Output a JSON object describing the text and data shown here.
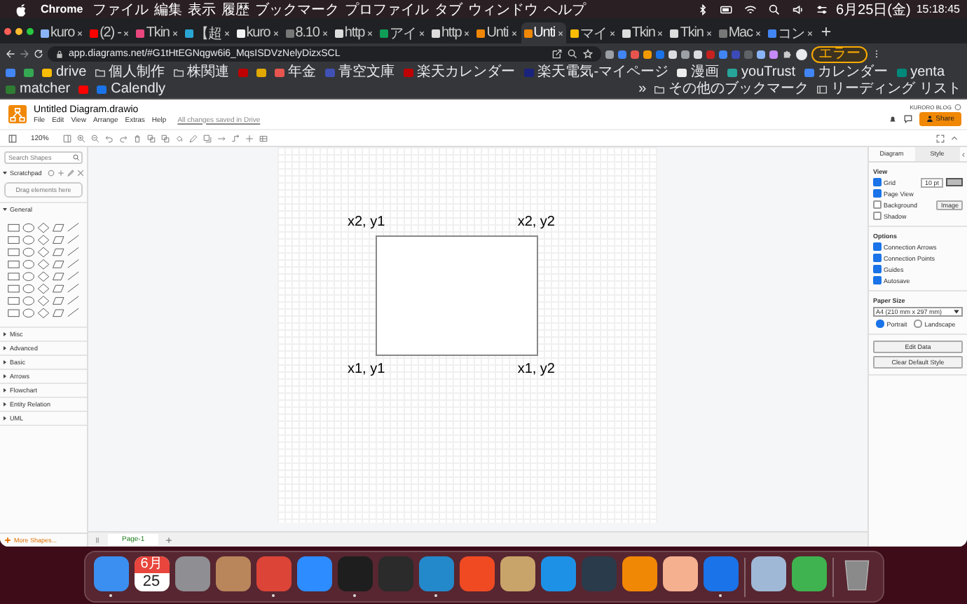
{
  "menubar": {
    "app": "Chrome",
    "menus": [
      "ファイル",
      "編集",
      "表示",
      "履歴",
      "ブックマーク",
      "プロファイル",
      "タブ",
      "ウィンドウ",
      "ヘルプ"
    ],
    "date": "6月25日(金)",
    "time": "15:18:45"
  },
  "tabs": [
    {
      "title": "kuro",
      "color": "#8ab4f8",
      "selected": false
    },
    {
      "title": "(2) -",
      "color": "#ff0000",
      "selected": false
    },
    {
      "title": "Tkin",
      "color": "#e8467c",
      "selected": false
    },
    {
      "title": "【超",
      "color": "#2aa6d5",
      "selected": false
    },
    {
      "title": "kuro",
      "color": "#f1f3f4",
      "selected": false
    },
    {
      "title": "8.10",
      "color": "#777777",
      "selected": false
    },
    {
      "title": "http",
      "color": "#dddddd",
      "selected": false
    },
    {
      "title": "アイ",
      "color": "#0f9d58",
      "selected": false
    },
    {
      "title": "http",
      "color": "#dddddd",
      "selected": false
    },
    {
      "title": "Unti",
      "color": "#f08705",
      "selected": false
    },
    {
      "title": "Unti",
      "color": "#f08705",
      "selected": true
    },
    {
      "title": "マイ",
      "color": "#fbbc04",
      "selected": false
    },
    {
      "title": "Tkin",
      "color": "#dddddd",
      "selected": false
    },
    {
      "title": "Tkin",
      "color": "#dddddd",
      "selected": false
    },
    {
      "title": "Mac",
      "color": "#777777",
      "selected": false
    },
    {
      "title": "コン",
      "color": "#4285f4",
      "selected": false
    }
  ],
  "address": "app.diagrams.net/#G1tHtEGNqgw6i6_MqsISDVzNelyDizxSCL",
  "profile_button": "エラー",
  "bookmarks": {
    "items": [
      {
        "kind": "site",
        "color": "#4285f4"
      },
      {
        "kind": "site",
        "color": "#34a853"
      },
      {
        "kind": "site",
        "color": "#fbbc04",
        "label": "drive"
      },
      {
        "kind": "folder",
        "label": "個人制作"
      },
      {
        "kind": "folder",
        "label": "株関連"
      },
      {
        "kind": "site",
        "color": "#bf0000"
      },
      {
        "kind": "site",
        "color": "#e0a800"
      },
      {
        "kind": "site",
        "color": "#e8554e",
        "label": "年金"
      },
      {
        "kind": "site",
        "color": "#3f51b5",
        "label": "青空文庫"
      },
      {
        "kind": "site",
        "color": "#bf0000",
        "label": "楽天カレンダー"
      },
      {
        "kind": "site",
        "color": "#1a237e",
        "label": "楽天電気-マイページ"
      },
      {
        "kind": "site",
        "color": "#eeeeee",
        "label": "漫画"
      },
      {
        "kind": "site",
        "color": "#26a69a",
        "label": "youTrust"
      },
      {
        "kind": "site",
        "color": "#4285f4",
        "label": "カレンダー"
      },
      {
        "kind": "site",
        "color": "#00897b",
        "label": "yenta"
      },
      {
        "kind": "site",
        "color": "#2e7d32",
        "label": "matcher"
      },
      {
        "kind": "site",
        "color": "#ff0000"
      },
      {
        "kind": "site",
        "color": "#1a73e8",
        "label": "Calendly"
      }
    ],
    "overflow": "»",
    "other": "その他のブックマーク",
    "reading_list": "リーディング リスト"
  },
  "app": {
    "title": "Untitled Diagram.drawio",
    "menus": [
      "File",
      "Edit",
      "View",
      "Arrange",
      "Extras",
      "Help"
    ],
    "save_status": "All changes saved in Drive",
    "account": "KURORO BLOG",
    "share": "Share",
    "zoom": "120%"
  },
  "sidebar": {
    "search_placeholder": "Search Shapes",
    "sections": [
      {
        "title": "Scratchpad",
        "kind": "scratchpad",
        "expanded": true,
        "hint": "Drag elements here"
      },
      {
        "title": "General",
        "kind": "shapes",
        "expanded": true
      },
      {
        "title": "Misc",
        "kind": "shapes",
        "expanded": false
      },
      {
        "title": "Advanced",
        "kind": "shapes",
        "expanded": false
      },
      {
        "title": "Basic",
        "kind": "shapes",
        "expanded": false
      },
      {
        "title": "Arrows",
        "kind": "shapes",
        "expanded": false
      },
      {
        "title": "Flowchart",
        "kind": "shapes",
        "expanded": false
      },
      {
        "title": "Entity Relation",
        "kind": "shapes",
        "expanded": false
      },
      {
        "title": "UML",
        "kind": "shapes",
        "expanded": false
      }
    ],
    "more_shapes": "More Shapes..."
  },
  "canvas": {
    "corner_labels": {
      "top_left": "x2, y1",
      "top_right": "x2, y2",
      "bottom_left": "x1, y1",
      "bottom_right": "x1, y2"
    }
  },
  "pages": [
    {
      "label": "Page-1",
      "selected": true
    }
  ],
  "format_panel": {
    "tabs": [
      {
        "label": "Diagram",
        "selected": true
      },
      {
        "label": "Style",
        "selected": false
      }
    ],
    "view": {
      "title": "View",
      "rows": [
        {
          "label": "Grid",
          "checked": true,
          "value": "10 pt"
        },
        {
          "label": "Page View",
          "checked": true
        },
        {
          "label": "Background",
          "checked": false,
          "button": "Image"
        },
        {
          "label": "Shadow",
          "checked": false
        }
      ]
    },
    "options": {
      "title": "Options",
      "rows": [
        {
          "label": "Connection Arrows",
          "checked": true
        },
        {
          "label": "Connection Points",
          "checked": true
        },
        {
          "label": "Guides",
          "checked": true
        },
        {
          "label": "Autosave",
          "checked": true
        }
      ]
    },
    "paper": {
      "title": "Paper Size",
      "size": "A4 (210 mm x 297 mm)",
      "orientations": [
        {
          "label": "Portrait",
          "selected": true
        },
        {
          "label": "Landscape",
          "selected": false
        }
      ]
    },
    "buttons": [
      "Edit Data",
      "Clear Default Style"
    ]
  },
  "dock": {
    "groups": [
      [
        {
          "kind": "app",
          "color": "#3b8ff0",
          "running": true
        },
        {
          "kind": "calendar",
          "month": "6月",
          "day": "25",
          "running": false
        },
        {
          "kind": "app",
          "color": "#8e8e93",
          "running": false
        },
        {
          "kind": "app",
          "color": "#b8865a",
          "running": false
        },
        {
          "kind": "app",
          "color": "#db4437",
          "running": true
        },
        {
          "kind": "app",
          "color": "#2d8cff",
          "running": false
        },
        {
          "kind": "app",
          "color": "#1e1e1e",
          "running": true
        },
        {
          "kind": "app",
          "color": "#2b2b2b",
          "running": false
        },
        {
          "kind": "app",
          "color": "#2489ca",
          "running": true
        },
        {
          "kind": "app",
          "color": "#f04a23",
          "running": false
        },
        {
          "kind": "app",
          "color": "#c9a46a",
          "running": false
        },
        {
          "kind": "app",
          "color": "#1d91e6",
          "running": false
        },
        {
          "kind": "app",
          "color": "#2a3b4c",
          "running": false
        },
        {
          "kind": "app",
          "color": "#f08705",
          "running": false
        },
        {
          "kind": "app",
          "color": "#f5b08f",
          "running": false
        },
        {
          "kind": "app",
          "color": "#1a73e8",
          "running": true
        }
      ],
      [
        {
          "kind": "app",
          "color": "#9fb8d6",
          "running": false
        },
        {
          "kind": "app",
          "color": "#3fb34f",
          "running": false
        }
      ],
      [
        {
          "kind": "trash",
          "running": false
        }
      ]
    ]
  }
}
